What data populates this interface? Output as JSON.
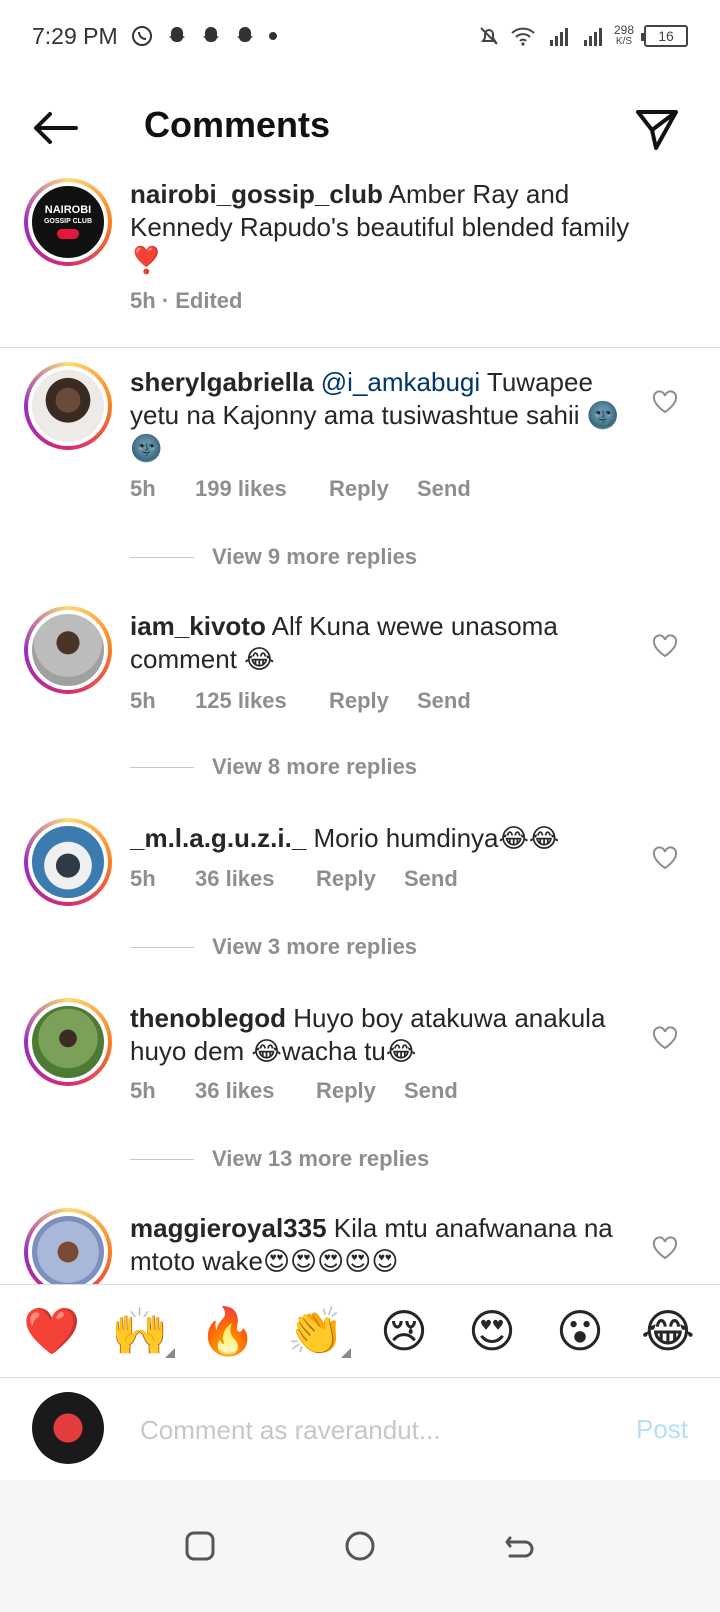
{
  "status_bar": {
    "time": "7:29 PM",
    "speed_value": "298",
    "speed_unit": "K/S",
    "battery": "16"
  },
  "header": {
    "title": "Comments"
  },
  "caption": {
    "username": "nairobi_gossip_club",
    "text": "Amber Ray and Kennedy Rapudo's beautiful blended family",
    "emoji": "❣️",
    "time": "5h",
    "edited": "· Edited",
    "logo_top": "NAIROBI",
    "logo_bottom": "GOSSIP CLUB"
  },
  "comments": [
    {
      "username": "sherylgabriella",
      "mention": "@i_amkabugi",
      "text": "Tuwapee yetu na Kajonny ama tusiwashtue sahii 🌚🌚",
      "time": "5h",
      "likes": "199 likes",
      "reply": "Reply",
      "send": "Send",
      "view_replies": "View 9 more replies"
    },
    {
      "username": "iam_kivoto",
      "mention": "",
      "text": "Alf Kuna wewe unasoma comment 😂",
      "time": "5h",
      "likes": "125 likes",
      "reply": "Reply",
      "send": "Send",
      "view_replies": "View 8 more replies"
    },
    {
      "username": "_m.l.a.g.u.z.i._",
      "mention": "",
      "text": "Morio humdinya😂😂",
      "time": "5h",
      "likes": "36 likes",
      "reply": "Reply",
      "send": "Send",
      "view_replies": "View 3 more replies"
    },
    {
      "username": "thenoblegod",
      "mention": "",
      "text": "Huyo boy atakuwa anakula huyo dem 😂wacha tu😂",
      "time": "5h",
      "likes": "36 likes",
      "reply": "Reply",
      "send": "Send",
      "view_replies": "View 13 more replies"
    },
    {
      "username": "maggieroyal335",
      "mention": "",
      "text": "Kila mtu anafwanana na mtoto wake😍😍😍😍😍"
    }
  ],
  "emoji_bar": [
    "❤️",
    "🙌",
    "🔥",
    "👏",
    "😢",
    "😍",
    "😮",
    "😂"
  ],
  "compose": {
    "placeholder": "Comment as raverandut...",
    "post": "Post"
  },
  "colors": {
    "link": "#00376b",
    "muted": "#8e8e8e",
    "post_disabled": "#b2dffc"
  }
}
